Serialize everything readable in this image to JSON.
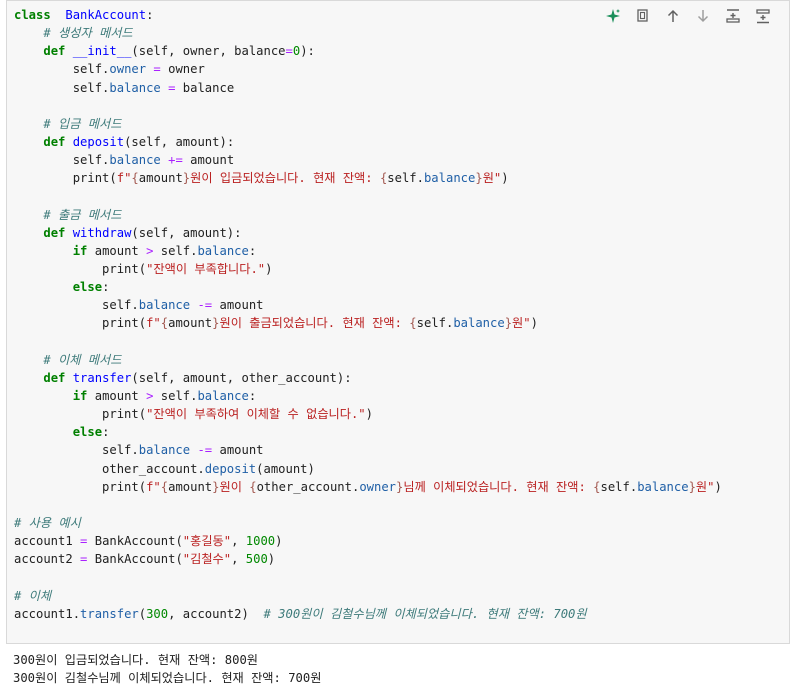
{
  "toolbar": {
    "buttons": [
      {
        "name": "sparkle-icon",
        "glyph": "✦"
      },
      {
        "name": "copy-icon",
        "glyph": "⧉"
      },
      {
        "name": "move-up-icon",
        "glyph": "↑"
      },
      {
        "name": "move-down-icon",
        "glyph": "↓"
      },
      {
        "name": "insert-above-icon",
        "glyph": "⊼"
      },
      {
        "name": "insert-below-icon",
        "glyph": "⊻"
      }
    ]
  },
  "code_lines": [
    [
      [
        "kw2",
        "class"
      ],
      [
        "",
        "  "
      ],
      [
        "fn",
        "BankAccount"
      ],
      [
        "",
        ":"
      ]
    ],
    [
      [
        "",
        "    "
      ],
      [
        "cm",
        "# 생성자 메서드"
      ]
    ],
    [
      [
        "",
        "    "
      ],
      [
        "kw2",
        "def"
      ],
      [
        "",
        " "
      ],
      [
        "fn",
        "__init__"
      ],
      [
        "",
        "(self, owner, balance"
      ],
      [
        "op",
        "="
      ],
      [
        "num",
        "0"
      ],
      [
        "",
        "):"
      ]
    ],
    [
      [
        "",
        "        self."
      ],
      [
        "attr",
        "owner"
      ],
      [
        "",
        " "
      ],
      [
        "op",
        "="
      ],
      [
        "",
        " owner"
      ]
    ],
    [
      [
        "",
        "        self."
      ],
      [
        "attr",
        "balance"
      ],
      [
        "",
        " "
      ],
      [
        "op",
        "="
      ],
      [
        "",
        " balance"
      ]
    ],
    [],
    [
      [
        "",
        "    "
      ],
      [
        "cm",
        "# 입금 메서드"
      ]
    ],
    [
      [
        "",
        "    "
      ],
      [
        "kw2",
        "def"
      ],
      [
        "",
        " "
      ],
      [
        "fn",
        "deposit"
      ],
      [
        "",
        "(self, amount):"
      ]
    ],
    [
      [
        "",
        "        self."
      ],
      [
        "attr",
        "balance"
      ],
      [
        "",
        " "
      ],
      [
        "op",
        "+="
      ],
      [
        "",
        " amount"
      ]
    ],
    [
      [
        "",
        "        print("
      ],
      [
        "str",
        "f\""
      ],
      [
        "fmt",
        "{"
      ],
      [
        "",
        "amount"
      ],
      [
        "fmt",
        "}"
      ],
      [
        "str",
        "원이 입금되었습니다. 현재 잔액: "
      ],
      [
        "fmt",
        "{"
      ],
      [
        "",
        "self."
      ],
      [
        "attr",
        "balance"
      ],
      [
        "fmt",
        "}"
      ],
      [
        "str",
        "원\""
      ],
      [
        "",
        ")"
      ]
    ],
    [],
    [
      [
        "",
        "    "
      ],
      [
        "cm",
        "# 출금 메서드"
      ]
    ],
    [
      [
        "",
        "    "
      ],
      [
        "kw2",
        "def"
      ],
      [
        "",
        " "
      ],
      [
        "fn",
        "withdraw"
      ],
      [
        "",
        "(self, amount):"
      ]
    ],
    [
      [
        "",
        "        "
      ],
      [
        "kw2",
        "if"
      ],
      [
        "",
        " amount "
      ],
      [
        "op",
        ">"
      ],
      [
        "",
        " self."
      ],
      [
        "attr",
        "balance"
      ],
      [
        "",
        ":"
      ]
    ],
    [
      [
        "",
        "            print("
      ],
      [
        "str",
        "\"잔액이 부족합니다.\""
      ],
      [
        "",
        ")"
      ]
    ],
    [
      [
        "",
        "        "
      ],
      [
        "kw2",
        "else"
      ],
      [
        "",
        ":"
      ]
    ],
    [
      [
        "",
        "            self."
      ],
      [
        "attr",
        "balance"
      ],
      [
        "",
        " "
      ],
      [
        "op",
        "-="
      ],
      [
        "",
        " amount"
      ]
    ],
    [
      [
        "",
        "            print("
      ],
      [
        "str",
        "f\""
      ],
      [
        "fmt",
        "{"
      ],
      [
        "",
        "amount"
      ],
      [
        "fmt",
        "}"
      ],
      [
        "str",
        "원이 출금되었습니다. 현재 잔액: "
      ],
      [
        "fmt",
        "{"
      ],
      [
        "",
        "self."
      ],
      [
        "attr",
        "balance"
      ],
      [
        "fmt",
        "}"
      ],
      [
        "str",
        "원\""
      ],
      [
        "",
        ")"
      ]
    ],
    [],
    [
      [
        "",
        "    "
      ],
      [
        "cm",
        "# 이체 메서드"
      ]
    ],
    [
      [
        "",
        "    "
      ],
      [
        "kw2",
        "def"
      ],
      [
        "",
        " "
      ],
      [
        "fn",
        "transfer"
      ],
      [
        "",
        "(self, amount, other_account):"
      ]
    ],
    [
      [
        "",
        "        "
      ],
      [
        "kw2",
        "if"
      ],
      [
        "",
        " amount "
      ],
      [
        "op",
        ">"
      ],
      [
        "",
        " self."
      ],
      [
        "attr",
        "balance"
      ],
      [
        "",
        ":"
      ]
    ],
    [
      [
        "",
        "            print("
      ],
      [
        "str",
        "\"잔액이 부족하여 이체할 수 없습니다.\""
      ],
      [
        "",
        ")"
      ]
    ],
    [
      [
        "",
        "        "
      ],
      [
        "kw2",
        "else"
      ],
      [
        "",
        ":"
      ]
    ],
    [
      [
        "",
        "            self."
      ],
      [
        "attr",
        "balance"
      ],
      [
        "",
        " "
      ],
      [
        "op",
        "-="
      ],
      [
        "",
        " amount"
      ]
    ],
    [
      [
        "",
        "            other_account."
      ],
      [
        "attr",
        "deposit"
      ],
      [
        "",
        "(amount)"
      ]
    ],
    [
      [
        "",
        "            print("
      ],
      [
        "str",
        "f\""
      ],
      [
        "fmt",
        "{"
      ],
      [
        "",
        "amount"
      ],
      [
        "fmt",
        "}"
      ],
      [
        "str",
        "원이 "
      ],
      [
        "fmt",
        "{"
      ],
      [
        "",
        "other_account."
      ],
      [
        "attr",
        "owner"
      ],
      [
        "fmt",
        "}"
      ],
      [
        "str",
        "님께 이체되었습니다. 현재 잔액: "
      ],
      [
        "fmt",
        "{"
      ],
      [
        "",
        "self."
      ],
      [
        "attr",
        "balance"
      ],
      [
        "fmt",
        "}"
      ],
      [
        "str",
        "원\""
      ],
      [
        "",
        ")"
      ]
    ],
    [],
    [
      [
        "cm",
        "# 사용 예시"
      ]
    ],
    [
      [
        "",
        "account1 "
      ],
      [
        "op",
        "="
      ],
      [
        "",
        " BankAccount("
      ],
      [
        "str",
        "\"홍길동\""
      ],
      [
        "",
        ", "
      ],
      [
        "num",
        "1000"
      ],
      [
        "",
        ")"
      ]
    ],
    [
      [
        "",
        "account2 "
      ],
      [
        "op",
        "="
      ],
      [
        "",
        " BankAccount("
      ],
      [
        "str",
        "\"김철수\""
      ],
      [
        "",
        ", "
      ],
      [
        "num",
        "500"
      ],
      [
        "",
        ")"
      ]
    ],
    [],
    [
      [
        "cm",
        "# 이체"
      ]
    ],
    [
      [
        "",
        "account1."
      ],
      [
        "attr",
        "transfer"
      ],
      [
        "",
        "("
      ],
      [
        "num",
        "300"
      ],
      [
        "",
        ", account2)  "
      ],
      [
        "cm",
        "# 300원이 김철수님께 이체되었습니다. 현재 잔액: 700원"
      ]
    ]
  ],
  "output": {
    "lines": [
      "300원이 입금되었습니다. 현재 잔액: 800원",
      "300원이 김철수님께 이체되었습니다. 현재 잔액: 700원"
    ]
  },
  "colors": {
    "keyword": "#008000",
    "function_name": "#0000ff",
    "comment": "#3d7a7a",
    "string": "#ba2121",
    "number": "#008800",
    "operator": "#aa22ff",
    "attribute": "#1f5fa6",
    "cell_background": "#f7f7f7"
  }
}
